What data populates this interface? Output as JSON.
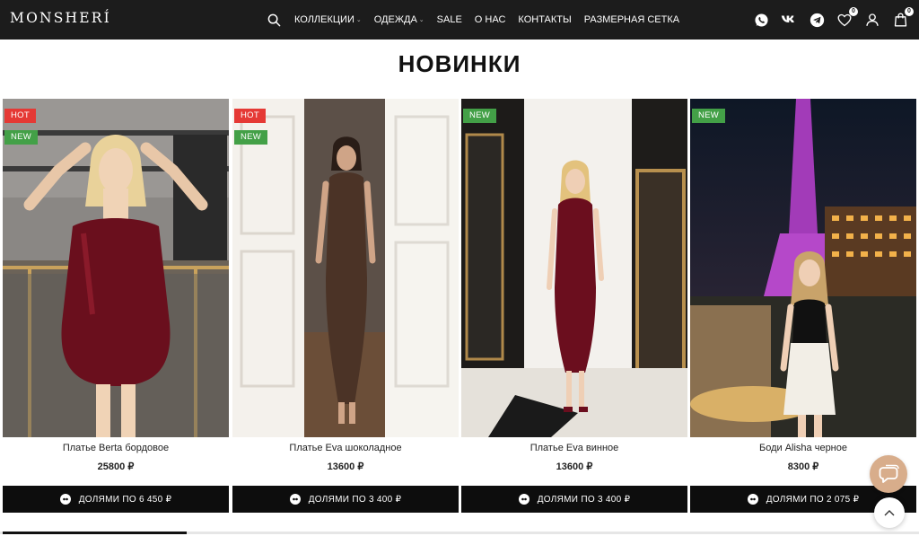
{
  "brand": {
    "logo_text": "MONSHERÍ"
  },
  "nav": {
    "items": [
      {
        "label": "КОЛЛЕКЦИИ",
        "has_dropdown": true
      },
      {
        "label": "ОДЕЖДА",
        "has_dropdown": true
      },
      {
        "label": "SALE",
        "has_dropdown": false
      },
      {
        "label": "О НАС",
        "has_dropdown": false
      },
      {
        "label": "КОНТАКТЫ",
        "has_dropdown": false
      },
      {
        "label": "РАЗМЕРНАЯ СЕТКА",
        "has_dropdown": false
      }
    ],
    "chevron": "⌄"
  },
  "header_icons": {
    "wishlist_count": "0",
    "cart_count": "0",
    "icons": [
      "search-icon",
      "whatsapp-icon",
      "vk-icon",
      "telegram-icon",
      "heart-icon",
      "user-icon",
      "cart-icon"
    ]
  },
  "section": {
    "title": "НОВИНКИ"
  },
  "products": [
    {
      "title": "Платье Berta бордовое",
      "price": "25800 ₽",
      "installment": "ДОЛЯМИ ПО 6 450 ₽",
      "labels": [
        "HOT",
        "NEW"
      ]
    },
    {
      "title": "Платье Eva шоколадное",
      "price": "13600 ₽",
      "installment": "ДОЛЯМИ ПО 3 400 ₽",
      "labels": [
        "HOT",
        "NEW"
      ]
    },
    {
      "title": "Платье Eva винное",
      "price": "13600 ₽",
      "installment": "ДОЛЯМИ ПО 3 400 ₽",
      "labels": [
        "NEW"
      ]
    },
    {
      "title": "Боди Alisha черное",
      "price": "8300 ₽",
      "installment": "ДОЛЯМИ ПО 2 075 ₽",
      "labels": [
        "NEW"
      ]
    }
  ],
  "slider": {
    "progress_fraction": 0.2
  },
  "colors": {
    "header_bg": "#1c1c1c",
    "hot_label": "#e53935",
    "new_label": "#43a047",
    "button_bg": "#0d0d0d",
    "chat_bg": "#d8ad8b"
  }
}
